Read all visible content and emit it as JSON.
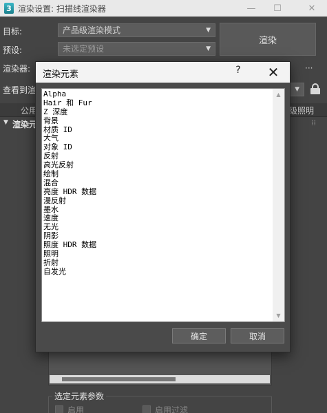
{
  "window": {
    "app_icon_glyph": "3",
    "title": "渲染设置: 扫描线渲染器",
    "minimize_glyph": "—",
    "maximize_glyph": "☐",
    "close_glyph": "✕"
  },
  "form": {
    "target_label": "目标:",
    "target_value": "产品级渲染模式",
    "preset_label": "预设:",
    "preset_value": "未选定预设",
    "renderer_label": "渲染器:",
    "view_label": "查看到渲",
    "render_button": "渲染",
    "more_glyph": "···",
    "dropdown_arrow": "▼"
  },
  "tabs": {
    "common": "公用",
    "advanced_lighting": "级照明"
  },
  "rollout": {
    "arrow": "▼",
    "title": "渲染元",
    "pin_glyph": "⁞⁞"
  },
  "selected_params": {
    "title": "选定元素参数",
    "enable_label": "启用",
    "enable_filter_label": "启用过滤"
  },
  "dialog": {
    "title": "渲染元素",
    "help_glyph": "?",
    "close_glyph": "✕",
    "items": [
      "Alpha",
      "Hair 和 Fur",
      "Z 深度",
      "背景",
      "材质 ID",
      "大气",
      "对象 ID",
      "反射",
      "高光反射",
      "绘制",
      "混合",
      "亮度 HDR 数据",
      "漫反射",
      "墨水",
      "速度",
      "无光",
      "阴影",
      "照度 HDR 数据",
      "照明",
      "折射",
      "自发光"
    ],
    "scroll_up_glyph": "▲",
    "scroll_down_glyph": "▼",
    "ok_button": "确定",
    "cancel_button": "取消"
  }
}
